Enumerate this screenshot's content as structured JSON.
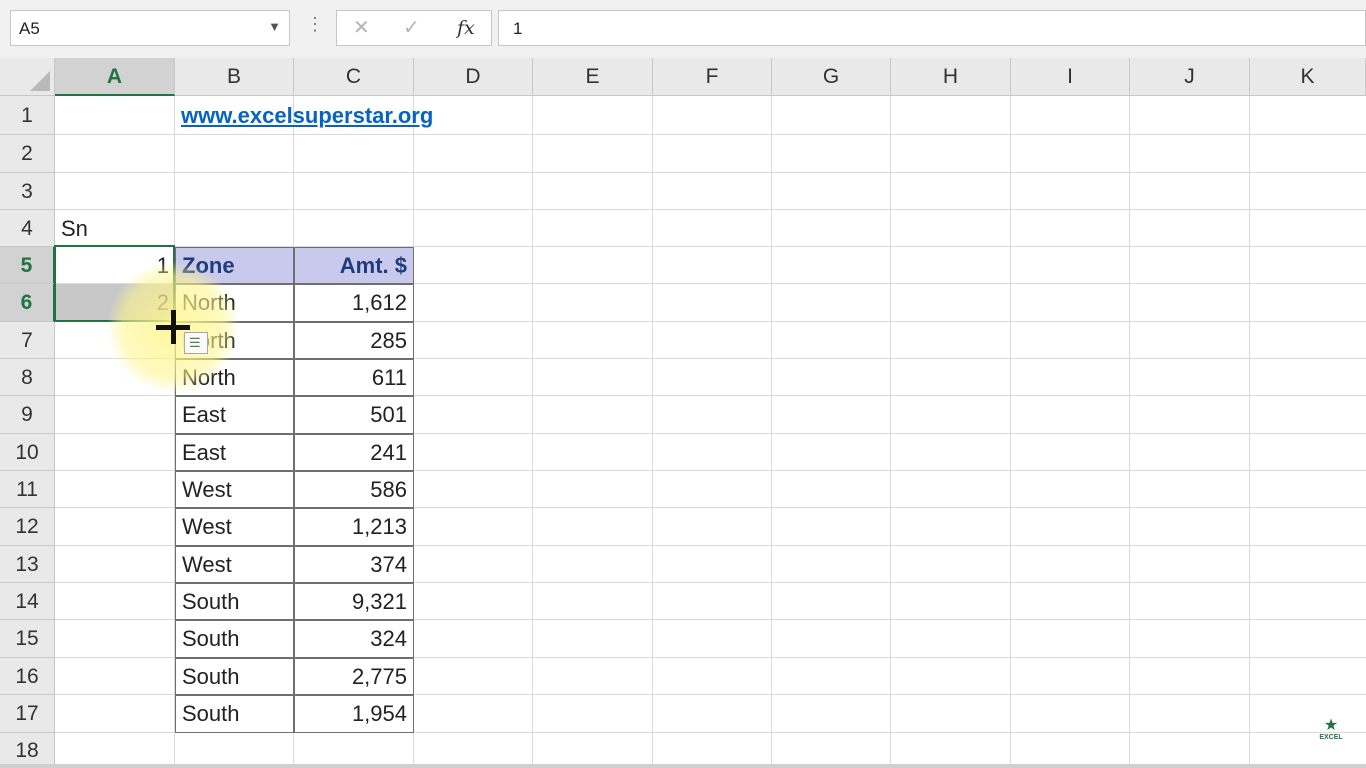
{
  "namebox": {
    "value": "A5",
    "arrow": "▼"
  },
  "formula_bar": {
    "dots": "⋮",
    "cancel": "✕",
    "enter": "✓",
    "fx": "fx",
    "value": "1"
  },
  "columns": [
    "A",
    "B",
    "C",
    "D",
    "E",
    "F",
    "G",
    "H",
    "I",
    "J",
    "K"
  ],
  "rows": [
    "1",
    "2",
    "3",
    "4",
    "5",
    "6",
    "7",
    "8",
    "9",
    "10",
    "11",
    "12",
    "13",
    "14",
    "15",
    "16",
    "17",
    "18"
  ],
  "cells": {
    "b1_link": "www.excelsuperstar.org",
    "a4": "Sn",
    "a5": "1",
    "a6": "2"
  },
  "table": {
    "headers": [
      "Zone",
      "Amt. $"
    ],
    "rows": [
      [
        "North",
        "1,612"
      ],
      [
        "North",
        "285"
      ],
      [
        "North",
        "611"
      ],
      [
        "East",
        "501"
      ],
      [
        "East",
        "241"
      ],
      [
        "West",
        "586"
      ],
      [
        "West",
        "1,213"
      ],
      [
        "West",
        "374"
      ],
      [
        "South",
        "9,321"
      ],
      [
        "South",
        "324"
      ],
      [
        "South",
        "2,775"
      ],
      [
        "South",
        "1,954"
      ]
    ]
  },
  "logo": {
    "star": "★",
    "text": "EXCEL"
  }
}
